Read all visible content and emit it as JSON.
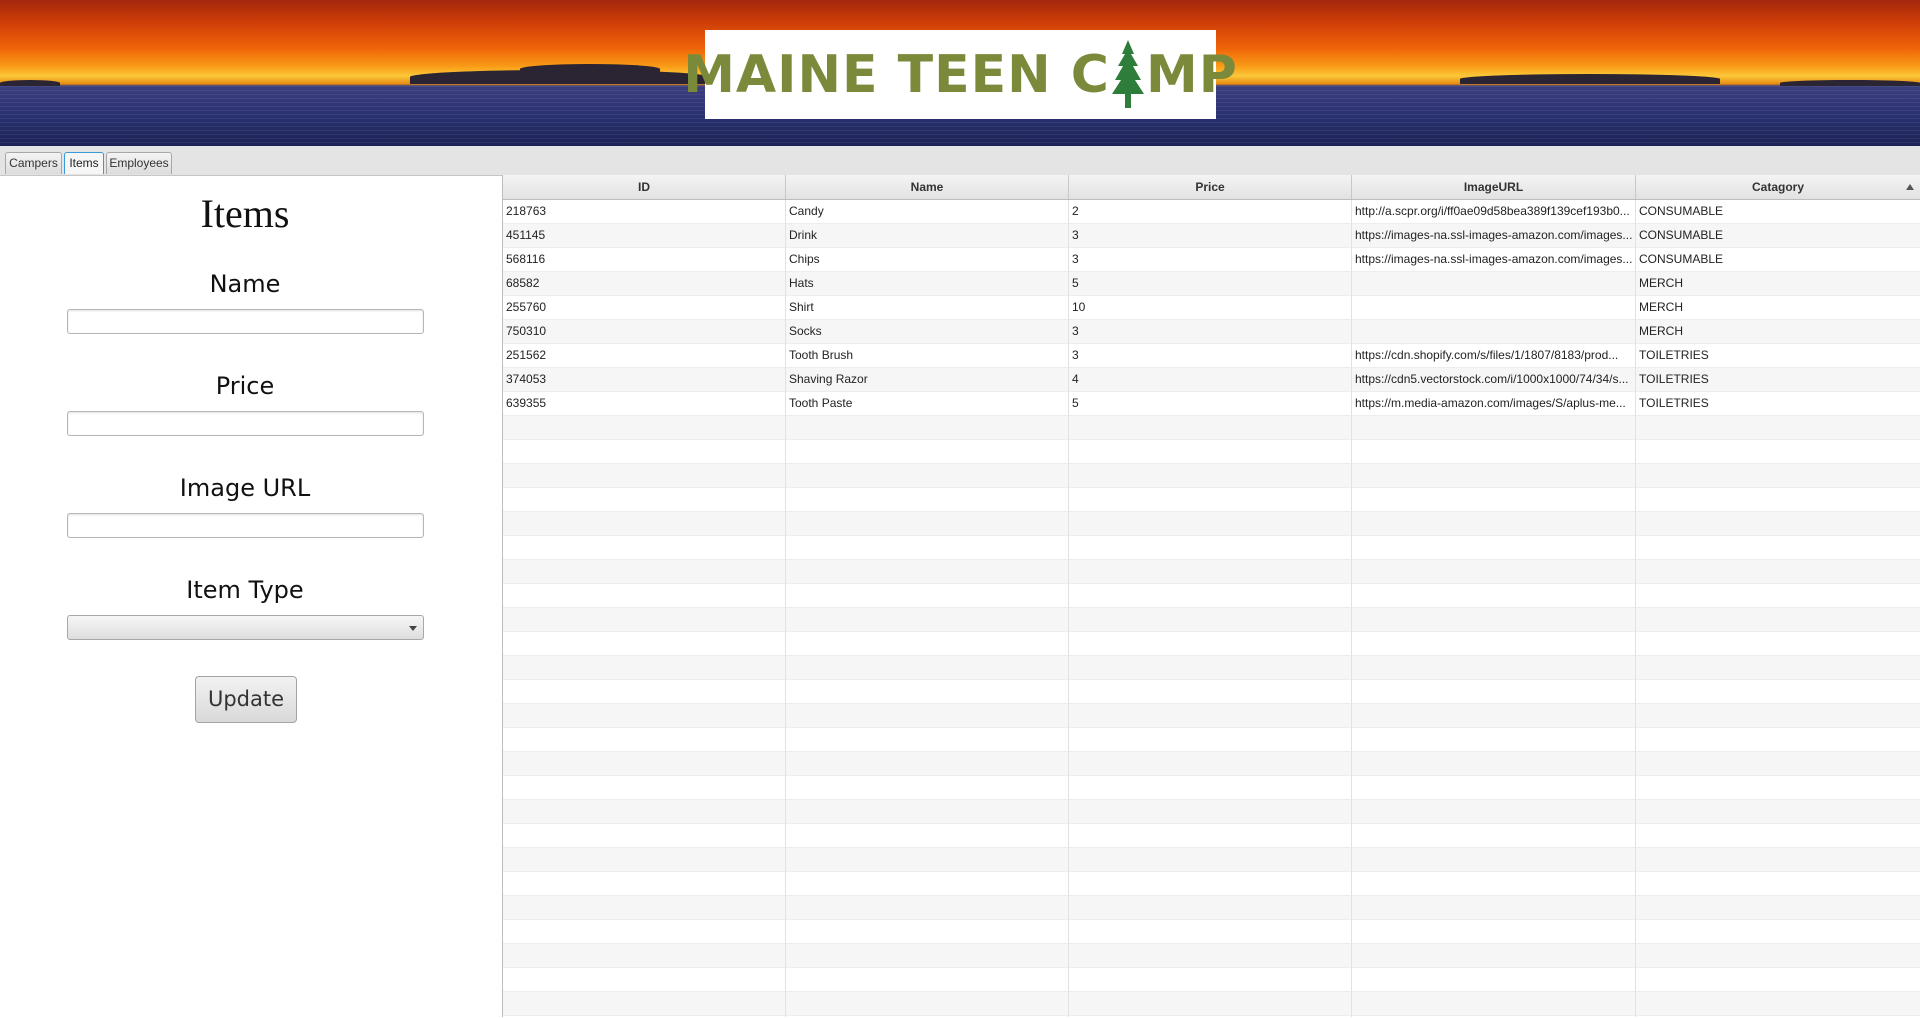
{
  "banner": {
    "logo_text_left": "MAINE TEEN C",
    "logo_text_right": "MP"
  },
  "tabs": [
    {
      "label": "Campers",
      "active": false
    },
    {
      "label": "Items",
      "active": true
    },
    {
      "label": "Employees",
      "active": false
    }
  ],
  "form": {
    "title": "Items",
    "name_label": "Name",
    "name_value": "",
    "price_label": "Price",
    "price_value": "",
    "image_url_label": "Image URL",
    "image_url_value": "",
    "item_type_label": "Item Type",
    "item_type_selected": "",
    "update_label": "Update"
  },
  "table": {
    "columns": [
      "ID",
      "Name",
      "Price",
      "ImageURL",
      "Catagory"
    ],
    "sorted_column": "Catagory",
    "sort_direction": "ascending",
    "rows": [
      [
        "218763",
        "Candy",
        "2",
        "http://a.scpr.org/i/ff0ae09d58bea389f139cef193b0...",
        "CONSUMABLE"
      ],
      [
        "451145",
        "Drink",
        "3",
        "https://images-na.ssl-images-amazon.com/images...",
        "CONSUMABLE"
      ],
      [
        "568116",
        "Chips",
        "3",
        "https://images-na.ssl-images-amazon.com/images...",
        "CONSUMABLE"
      ],
      [
        "68582",
        "Hats",
        "5",
        "",
        "MERCH"
      ],
      [
        "255760",
        "Shirt",
        "10",
        "",
        "MERCH"
      ],
      [
        "750310",
        "Socks",
        "3",
        "",
        "MERCH"
      ],
      [
        "251562",
        "Tooth Brush",
        "3",
        "https://cdn.shopify.com/s/files/1/1807/8183/prod...",
        "TOILETRIES"
      ],
      [
        "374053",
        "Shaving Razor",
        "4",
        "https://cdn5.vectorstock.com/i/1000x1000/74/34/s...",
        "TOILETRIES"
      ],
      [
        "639355",
        "Tooth Paste",
        "5",
        "https://m.media-amazon.com/images/S/aplus-me...",
        "TOILETRIES"
      ]
    ]
  },
  "colors": {
    "logo_green": "#7a8a3a",
    "tree_green": "#2e7d3a",
    "active_tab_border": "#3a9ad9"
  }
}
